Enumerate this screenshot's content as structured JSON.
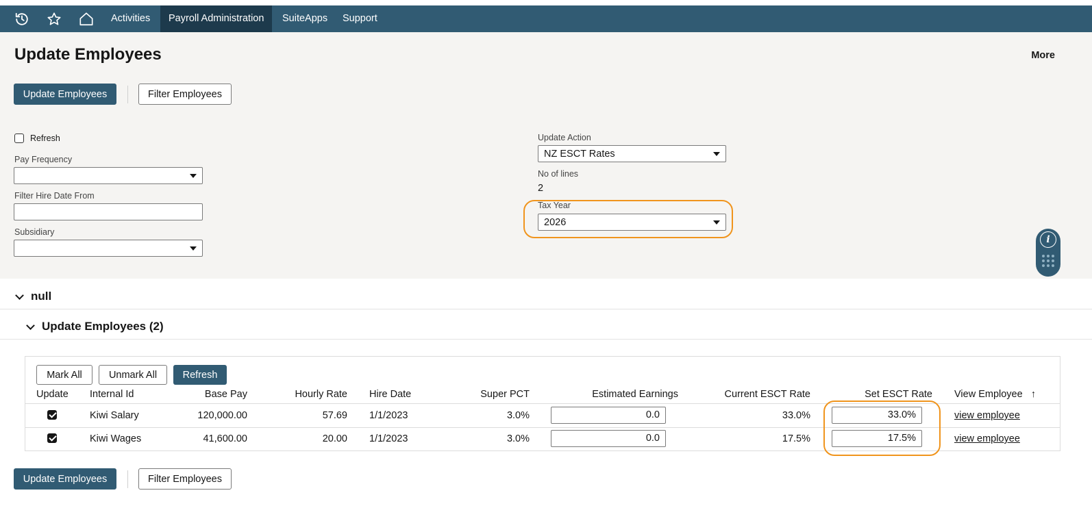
{
  "nav": {
    "items": [
      {
        "label": "Activities"
      },
      {
        "label": "Payroll Administration"
      },
      {
        "label": "SuiteApps"
      },
      {
        "label": "Support"
      }
    ]
  },
  "page": {
    "title": "Update Employees",
    "more_label": "More"
  },
  "buttons": {
    "update_employees": "Update Employees",
    "filter_employees": "Filter Employees",
    "mark_all": "Mark All",
    "unmark_all": "Unmark All",
    "refresh": "Refresh"
  },
  "form": {
    "refresh_label": "Refresh",
    "refresh_checked": false,
    "pay_frequency_label": "Pay Frequency",
    "pay_frequency_value": "",
    "hire_date_from_label": "Filter Hire Date From",
    "hire_date_from_value": "",
    "subsidiary_label": "Subsidiary",
    "subsidiary_value": "",
    "update_action_label": "Update Action",
    "update_action_value": "NZ ESCT Rates",
    "no_of_lines_label": "No of lines",
    "no_of_lines_value": "2",
    "tax_year_label": "Tax Year",
    "tax_year_value": "2026"
  },
  "sections": {
    "null_title": "null",
    "sublist_title": "Update Employees (2)"
  },
  "table": {
    "headers": {
      "update": "Update",
      "internal_id": "Internal Id",
      "base_pay": "Base Pay",
      "hourly_rate": "Hourly Rate",
      "hire_date": "Hire Date",
      "super_pct": "Super PCT",
      "estimated_earnings": "Estimated Earnings",
      "current_esct": "Current ESCT Rate",
      "set_esct": "Set ESCT Rate",
      "view_employee": "View Employee",
      "sort_arrow": "↑"
    },
    "rows": [
      {
        "checked": true,
        "internal_id": "Kiwi Salary",
        "base_pay": "120,000.00",
        "hourly_rate": "57.69",
        "hire_date": "1/1/2023",
        "super_pct": "3.0%",
        "estimated_earnings": "0.0",
        "current_esct": "33.0%",
        "set_esct": "33.0%",
        "view_link": "view employee"
      },
      {
        "checked": true,
        "internal_id": "Kiwi Wages",
        "base_pay": "41,600.00",
        "hourly_rate": "20.00",
        "hire_date": "1/1/2023",
        "super_pct": "3.0%",
        "estimated_earnings": "0.0",
        "current_esct": "17.5%",
        "set_esct": "17.5%",
        "view_link": "view employee"
      }
    ]
  },
  "colors": {
    "nav_bg": "#315b73",
    "nav_active": "#1d3a4c",
    "highlight": "#f0941c",
    "panel_bg": "#f5f4f2"
  },
  "icons": [
    "history-icon",
    "star-icon",
    "home-icon",
    "info-icon",
    "grip-icon",
    "chevron-down-icon"
  ]
}
